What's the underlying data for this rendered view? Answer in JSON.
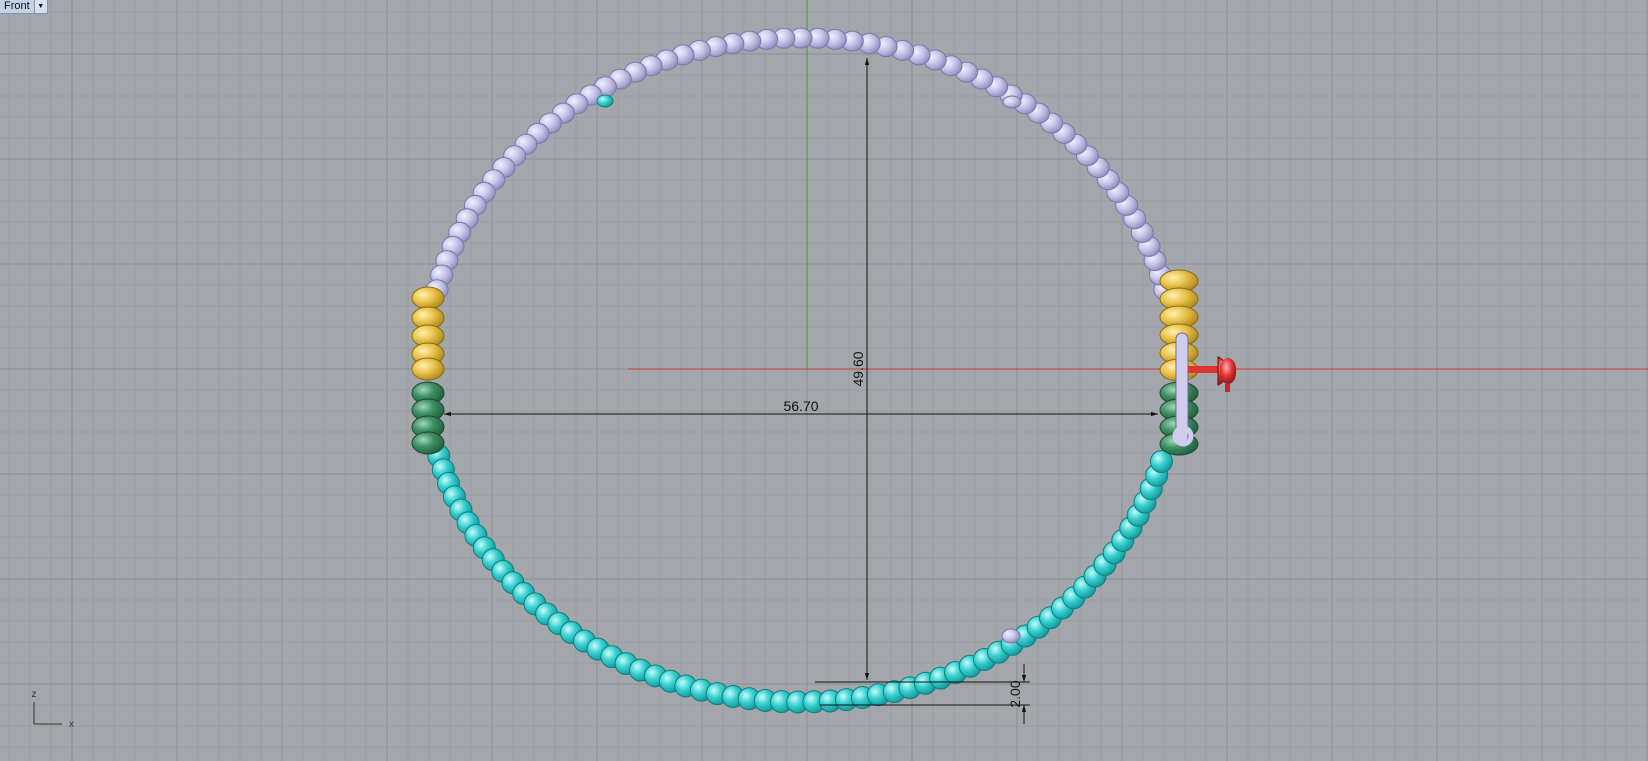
{
  "viewport": {
    "name": "Front",
    "background": "#a3a6ab",
    "grid_minor_color": "#989ca1",
    "grid_major_color": "#8b8f95",
    "x_axis_color": "#c73a3a",
    "y_axis_color": "#3a9a3a"
  },
  "dimensions": {
    "width_label": "56.70",
    "height_label": "49.60",
    "thickness_label": "2.00"
  },
  "axis_indicator": {
    "vertical": "z",
    "horizontal": "x"
  },
  "bead_colors": {
    "lavender": "#c8c5ea",
    "cyan": "#3ecac9",
    "yellow": "#e8c24d",
    "green": "#3e8d62",
    "clasp": "#cfcdee",
    "gumball": "#e03535"
  }
}
